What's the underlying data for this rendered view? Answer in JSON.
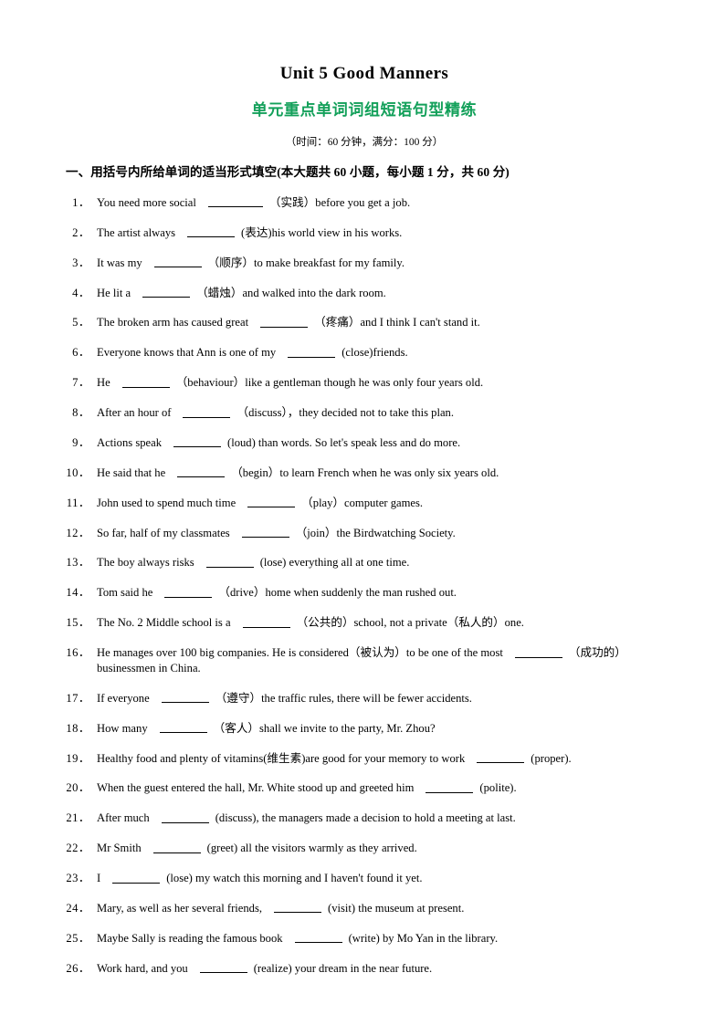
{
  "document": {
    "title": "Unit 5 Good Manners",
    "subtitle": "单元重点单词词组短语句型精练",
    "subtitle_color": "#13a05a",
    "meta": "（时间：60 分钟，满分：100 分）",
    "section_heading": "一、用括号内所给单词的适当形式填空(本大题共 60 小题，每小题 1 分，共 60 分)"
  },
  "questions": [
    {
      "num": "1．",
      "pre": "You need more social",
      "blank": "lg",
      "post": "（实践）before you get a job."
    },
    {
      "num": "2．",
      "pre": "The artist always",
      "blank": "md",
      "post": "(表达)his world view in his works."
    },
    {
      "num": "3．",
      "pre": "It was my",
      "blank": "md",
      "post": "（顺序）to make breakfast for my family."
    },
    {
      "num": "4．",
      "pre": "He lit a",
      "blank": "md",
      "post": "（蜡烛）and walked into the dark room."
    },
    {
      "num": "5．",
      "pre": "The broken arm has caused great",
      "blank": "md",
      "post": "（疼痛）and I think I can't stand it."
    },
    {
      "num": "6．",
      "pre": "Everyone knows that Ann is one of my",
      "blank": "md",
      "post": "(close)friends."
    },
    {
      "num": "7．",
      "pre": "He",
      "blank": "md",
      "post": "（behaviour）like a gentleman though he was only four years old."
    },
    {
      "num": "8．",
      "pre": "After an hour of",
      "blank": "md",
      "post": "（discuss），they decided not to take this plan."
    },
    {
      "num": "9．",
      "pre": "Actions speak",
      "blank": "md",
      "post": "(loud) than words. So let's speak less and do more."
    },
    {
      "num": "10．",
      "pre": "He said that he",
      "blank": "md",
      "post": "（begin）to learn French when he was only six years old."
    },
    {
      "num": "11．",
      "pre": "John used to spend much time",
      "blank": "md",
      "post": "（play）computer games."
    },
    {
      "num": "12．",
      "pre": "So far, half of my classmates",
      "blank": "md",
      "post": "（join）the Birdwatching Society."
    },
    {
      "num": "13．",
      "pre": "The boy always risks",
      "blank": "md",
      "post": "(lose) everything all at one time."
    },
    {
      "num": "14．",
      "pre": "Tom said he",
      "blank": "md",
      "post": "（drive）home when suddenly the man rushed out."
    },
    {
      "num": "15．",
      "pre": "The No. 2 Middle school is a",
      "blank": "md",
      "post": "（公共的）school, not a private（私人的）one."
    },
    {
      "num": "16．",
      "pre": "He manages over 100 big companies. He is considered（被认为）to be one of the most",
      "blank": "md",
      "post": "（成功的）businessmen in China."
    },
    {
      "num": "17．",
      "pre": "If everyone",
      "blank": "md",
      "post": "（遵守）the traffic rules, there will be fewer accidents."
    },
    {
      "num": "18．",
      "pre": "How many",
      "blank": "md",
      "post": "（客人）shall we invite to the party, Mr. Zhou?"
    },
    {
      "num": "19．",
      "pre": "Healthy food and plenty of vitamins(维生素)are good for your memory to work",
      "blank": "md",
      "post": "(proper)."
    },
    {
      "num": "20．",
      "pre": "When the guest entered the hall, Mr. White stood up and greeted him",
      "blank": "md",
      "post": "(polite)."
    },
    {
      "num": "21．",
      "pre": "After much",
      "blank": "md",
      "post": "(discuss), the managers made a decision to hold a meeting at last."
    },
    {
      "num": "22．",
      "pre": "Mr Smith",
      "blank": "md",
      "post": "(greet) all the visitors warmly as they arrived."
    },
    {
      "num": "23．",
      "pre": "I",
      "blank": "md",
      "post": "(lose) my watch this morning and I haven't found it yet."
    },
    {
      "num": "24．",
      "pre": "Mary, as well as her several friends,",
      "blank": "md",
      "post": "(visit) the museum at present."
    },
    {
      "num": "25．",
      "pre": "Maybe Sally is reading the famous book",
      "blank": "md",
      "post": "(write) by Mo Yan in the library."
    },
    {
      "num": "26．",
      "pre": "Work hard, and you",
      "blank": "md",
      "post": "(realize) your dream in the near future."
    }
  ]
}
